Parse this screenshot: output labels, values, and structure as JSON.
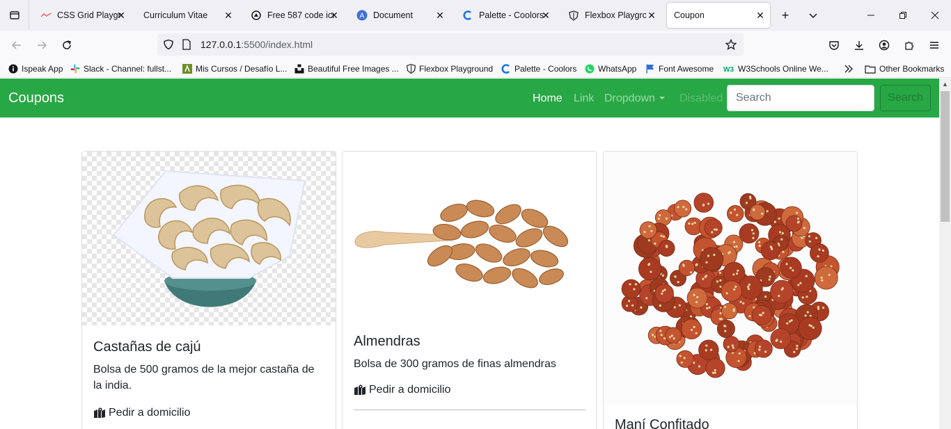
{
  "browser": {
    "tabs": [
      {
        "title": "CSS Grid Playground",
        "favicon": "css-grid-icon",
        "active": false
      },
      {
        "title": "Curriculum Vitae",
        "favicon": "blank-icon",
        "active": false
      },
      {
        "title": "Free 587 code icons",
        "favicon": "code-icon",
        "active": false
      },
      {
        "title": "Document",
        "favicon": "document-icon",
        "active": false
      },
      {
        "title": "Palette - Coolors",
        "favicon": "coolors-icon",
        "active": false
      },
      {
        "title": "Flexbox Playground",
        "favicon": "shield-icon",
        "active": false
      },
      {
        "title": "Coupon",
        "favicon": "none",
        "active": true
      }
    ],
    "url": {
      "host": "127.0.0.1",
      "path": ":5500/index.html"
    },
    "bookmarks": [
      {
        "label": "Ispeak App",
        "icon": "ispeak-icon"
      },
      {
        "label": "Slack - Channel: fullst...",
        "icon": "slack-icon"
      },
      {
        "label": "Mis Cursos / Desafío L...",
        "icon": "desafio-icon"
      },
      {
        "label": "Beautiful Free Images ...",
        "icon": "unsplash-icon"
      },
      {
        "label": "Flexbox Playground",
        "icon": "shield-icon"
      },
      {
        "label": "Palette - Coolors",
        "icon": "coolors-icon"
      },
      {
        "label": "WhatsApp",
        "icon": "whatsapp-icon"
      },
      {
        "label": "Font Awesome",
        "icon": "flag-icon"
      },
      {
        "label": "W3Schools Online We...",
        "icon": "w3schools-icon"
      }
    ],
    "other_bookmarks": "Other Bookmarks"
  },
  "site": {
    "brand": "Coupons",
    "nav": {
      "home": "Home",
      "link": "Link",
      "dropdown": "Dropdown",
      "disabled": "Disabled"
    },
    "search": {
      "placeholder": "Search",
      "button": "Search"
    },
    "accent": "#28a745"
  },
  "cards": [
    {
      "title": "Castañas de cajú",
      "text": "Bolsa de 500 gramos de la mejor castaña de la india.",
      "link": "Pedir a domicilio"
    },
    {
      "title": "Almendras",
      "text": "Bolsa de 300 gramos de finas almendras",
      "link": "Pedir a domicilio"
    },
    {
      "title": "Maní Confitado"
    }
  ]
}
